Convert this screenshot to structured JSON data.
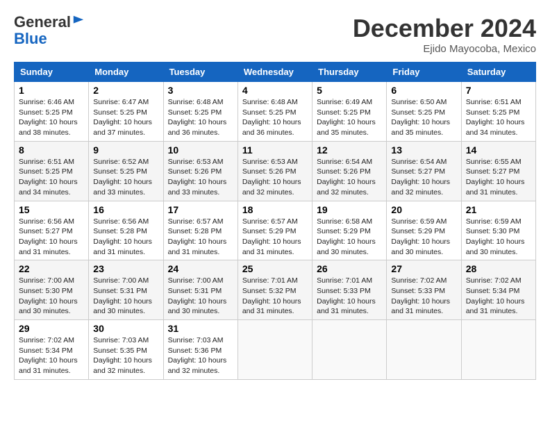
{
  "header": {
    "logo_line1": "General",
    "logo_line2": "Blue",
    "month": "December 2024",
    "location": "Ejido Mayocoba, Mexico"
  },
  "weekdays": [
    "Sunday",
    "Monday",
    "Tuesday",
    "Wednesday",
    "Thursday",
    "Friday",
    "Saturday"
  ],
  "weeks": [
    [
      {
        "day": "1",
        "info": "Sunrise: 6:46 AM\nSunset: 5:25 PM\nDaylight: 10 hours\nand 38 minutes."
      },
      {
        "day": "2",
        "info": "Sunrise: 6:47 AM\nSunset: 5:25 PM\nDaylight: 10 hours\nand 37 minutes."
      },
      {
        "day": "3",
        "info": "Sunrise: 6:48 AM\nSunset: 5:25 PM\nDaylight: 10 hours\nand 36 minutes."
      },
      {
        "day": "4",
        "info": "Sunrise: 6:48 AM\nSunset: 5:25 PM\nDaylight: 10 hours\nand 36 minutes."
      },
      {
        "day": "5",
        "info": "Sunrise: 6:49 AM\nSunset: 5:25 PM\nDaylight: 10 hours\nand 35 minutes."
      },
      {
        "day": "6",
        "info": "Sunrise: 6:50 AM\nSunset: 5:25 PM\nDaylight: 10 hours\nand 35 minutes."
      },
      {
        "day": "7",
        "info": "Sunrise: 6:51 AM\nSunset: 5:25 PM\nDaylight: 10 hours\nand 34 minutes."
      }
    ],
    [
      {
        "day": "8",
        "info": "Sunrise: 6:51 AM\nSunset: 5:25 PM\nDaylight: 10 hours\nand 34 minutes."
      },
      {
        "day": "9",
        "info": "Sunrise: 6:52 AM\nSunset: 5:25 PM\nDaylight: 10 hours\nand 33 minutes."
      },
      {
        "day": "10",
        "info": "Sunrise: 6:53 AM\nSunset: 5:26 PM\nDaylight: 10 hours\nand 33 minutes."
      },
      {
        "day": "11",
        "info": "Sunrise: 6:53 AM\nSunset: 5:26 PM\nDaylight: 10 hours\nand 32 minutes."
      },
      {
        "day": "12",
        "info": "Sunrise: 6:54 AM\nSunset: 5:26 PM\nDaylight: 10 hours\nand 32 minutes."
      },
      {
        "day": "13",
        "info": "Sunrise: 6:54 AM\nSunset: 5:27 PM\nDaylight: 10 hours\nand 32 minutes."
      },
      {
        "day": "14",
        "info": "Sunrise: 6:55 AM\nSunset: 5:27 PM\nDaylight: 10 hours\nand 31 minutes."
      }
    ],
    [
      {
        "day": "15",
        "info": "Sunrise: 6:56 AM\nSunset: 5:27 PM\nDaylight: 10 hours\nand 31 minutes."
      },
      {
        "day": "16",
        "info": "Sunrise: 6:56 AM\nSunset: 5:28 PM\nDaylight: 10 hours\nand 31 minutes."
      },
      {
        "day": "17",
        "info": "Sunrise: 6:57 AM\nSunset: 5:28 PM\nDaylight: 10 hours\nand 31 minutes."
      },
      {
        "day": "18",
        "info": "Sunrise: 6:57 AM\nSunset: 5:29 PM\nDaylight: 10 hours\nand 31 minutes."
      },
      {
        "day": "19",
        "info": "Sunrise: 6:58 AM\nSunset: 5:29 PM\nDaylight: 10 hours\nand 30 minutes."
      },
      {
        "day": "20",
        "info": "Sunrise: 6:59 AM\nSunset: 5:29 PM\nDaylight: 10 hours\nand 30 minutes."
      },
      {
        "day": "21",
        "info": "Sunrise: 6:59 AM\nSunset: 5:30 PM\nDaylight: 10 hours\nand 30 minutes."
      }
    ],
    [
      {
        "day": "22",
        "info": "Sunrise: 7:00 AM\nSunset: 5:30 PM\nDaylight: 10 hours\nand 30 minutes."
      },
      {
        "day": "23",
        "info": "Sunrise: 7:00 AM\nSunset: 5:31 PM\nDaylight: 10 hours\nand 30 minutes."
      },
      {
        "day": "24",
        "info": "Sunrise: 7:00 AM\nSunset: 5:31 PM\nDaylight: 10 hours\nand 30 minutes."
      },
      {
        "day": "25",
        "info": "Sunrise: 7:01 AM\nSunset: 5:32 PM\nDaylight: 10 hours\nand 31 minutes."
      },
      {
        "day": "26",
        "info": "Sunrise: 7:01 AM\nSunset: 5:33 PM\nDaylight: 10 hours\nand 31 minutes."
      },
      {
        "day": "27",
        "info": "Sunrise: 7:02 AM\nSunset: 5:33 PM\nDaylight: 10 hours\nand 31 minutes."
      },
      {
        "day": "28",
        "info": "Sunrise: 7:02 AM\nSunset: 5:34 PM\nDaylight: 10 hours\nand 31 minutes."
      }
    ],
    [
      {
        "day": "29",
        "info": "Sunrise: 7:02 AM\nSunset: 5:34 PM\nDaylight: 10 hours\nand 31 minutes."
      },
      {
        "day": "30",
        "info": "Sunrise: 7:03 AM\nSunset: 5:35 PM\nDaylight: 10 hours\nand 32 minutes."
      },
      {
        "day": "31",
        "info": "Sunrise: 7:03 AM\nSunset: 5:36 PM\nDaylight: 10 hours\nand 32 minutes."
      },
      null,
      null,
      null,
      null
    ]
  ]
}
